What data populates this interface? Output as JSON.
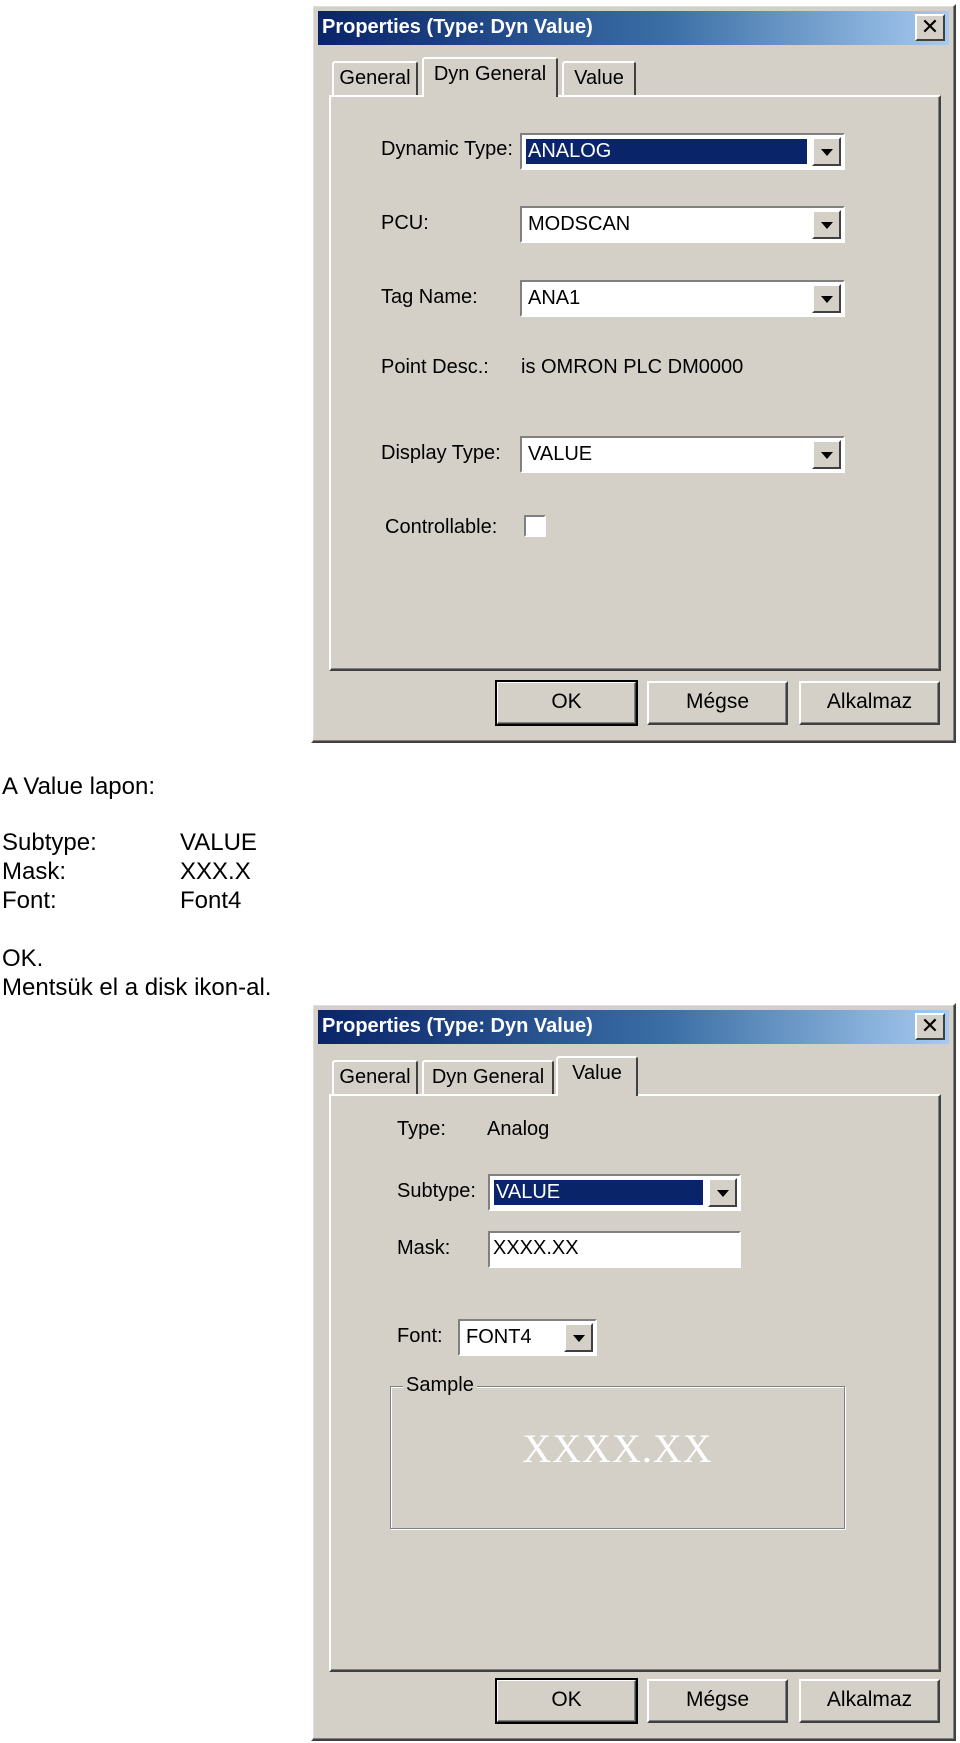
{
  "dialog1": {
    "title": "Properties (Type: Dyn Value)",
    "close": "✕",
    "tabs": [
      "General",
      "Dyn General",
      "Value"
    ],
    "active_tab": "Dyn General",
    "fields": {
      "dynamic_type_label": "Dynamic Type:",
      "dynamic_type_value": "ANALOG",
      "pcu_label": "PCU:",
      "pcu_value": "MODSCAN",
      "tag_name_label": "Tag Name:",
      "tag_name_value": "ANA1",
      "point_desc_label": "Point Desc.:",
      "point_desc_value": "is OMRON PLC DM0000",
      "display_type_label": "Display Type:",
      "display_type_value": "VALUE",
      "controllable_label": "Controllable:",
      "controllable_checked": false
    },
    "buttons": {
      "ok": "OK",
      "cancel": "Mégse",
      "apply": "Alkalmaz"
    }
  },
  "instructions": {
    "intro": "A Value lapon:",
    "rows": [
      {
        "label": "Subtype:",
        "value": "VALUE"
      },
      {
        "label": "Mask:",
        "value": "XXX.X"
      },
      {
        "label": "Font:",
        "value": "Font4"
      }
    ],
    "ok_line": "OK.",
    "save_line": "Mentsük el a disk ikon-al."
  },
  "dialog2": {
    "title": "Properties (Type: Dyn Value)",
    "close": "✕",
    "tabs": [
      "General",
      "Dyn General",
      "Value"
    ],
    "active_tab": "Value",
    "fields": {
      "type_label": "Type:",
      "type_value": "Analog",
      "subtype_label": "Subtype:",
      "subtype_value": "VALUE",
      "mask_label": "Mask:",
      "mask_value": "XXXX.XX",
      "font_label": "Font:",
      "font_value": "FONT4",
      "sample_label": "Sample",
      "sample_value": "XXXX.XX"
    },
    "buttons": {
      "ok": "OK",
      "cancel": "Mégse",
      "apply": "Alkalmaz"
    }
  }
}
